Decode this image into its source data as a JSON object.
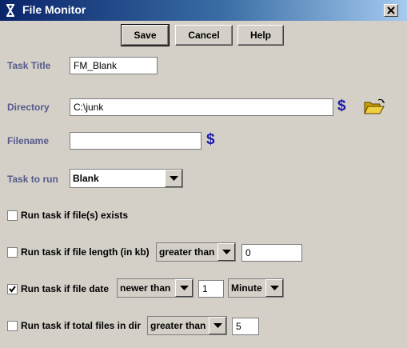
{
  "window": {
    "title": "File Monitor",
    "icon": "java-app-icon",
    "close": "close-icon"
  },
  "toolbar": {
    "save_label": "Save",
    "cancel_label": "Cancel",
    "help_label": "Help"
  },
  "form": {
    "task_title_label": "Task Title",
    "task_title_value": "FM_Blank",
    "directory_label": "Directory",
    "directory_value": "C:\\junk",
    "filename_label": "Filename",
    "filename_value": "",
    "variable_symbol": "$",
    "folder_icon": "open-folder-icon",
    "task_to_run_label": "Task to run",
    "task_to_run_value": "Blank"
  },
  "conditions": {
    "file_exists": {
      "label": "Run task if file(s) exists",
      "checked": false
    },
    "file_length": {
      "label": "Run task if file length (in kb)",
      "checked": false,
      "operator": "greater than",
      "value": "0"
    },
    "file_date": {
      "label": "Run task if file date",
      "checked": true,
      "operator": "newer than",
      "value": "1",
      "unit": "Minute"
    },
    "total_files": {
      "label": "Run task if total files in dir",
      "checked": false,
      "operator": "greater than",
      "value": "5"
    }
  },
  "colors": {
    "label": "#555a8c",
    "dollar": "#1a1aaa",
    "title_gradient_start": "#0a246a",
    "background": "#d4d0c8"
  }
}
